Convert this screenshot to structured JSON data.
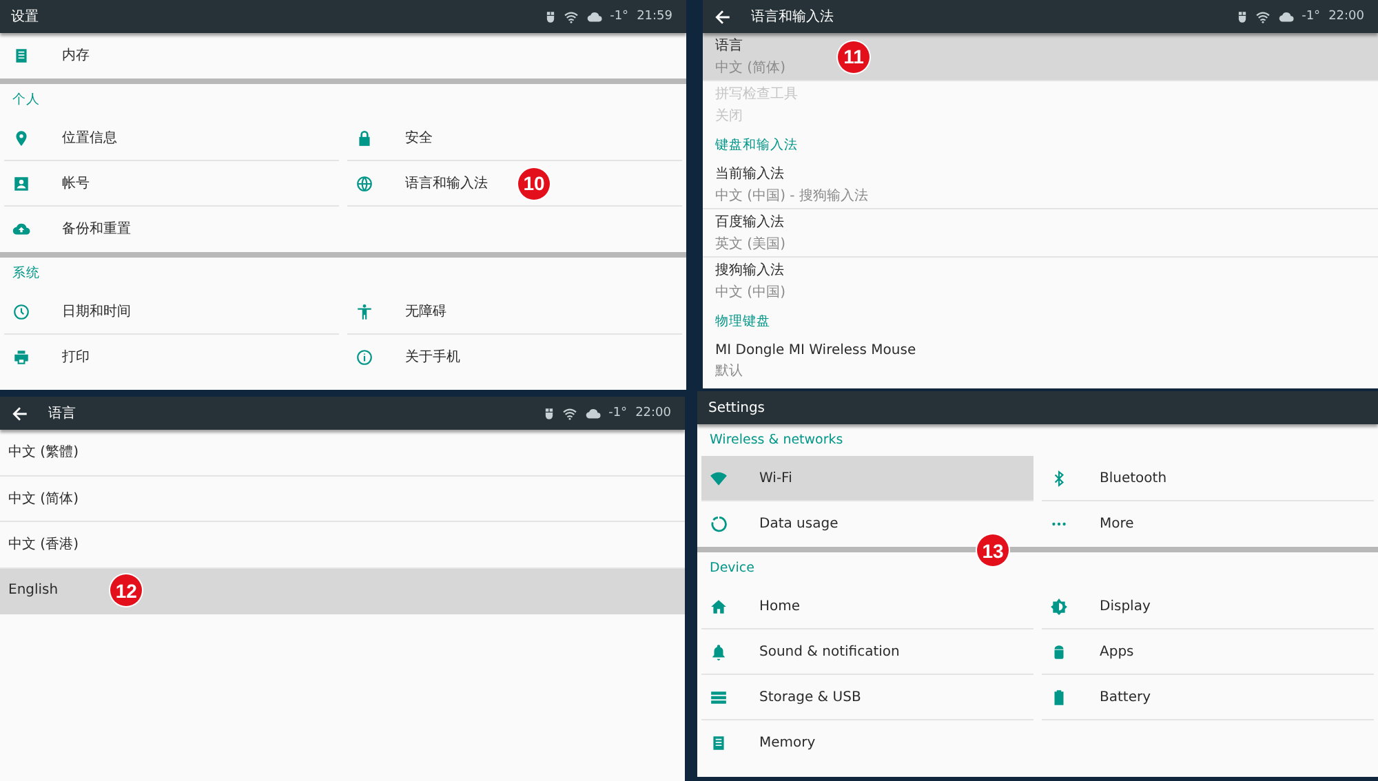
{
  "panels": [
    {
      "kind": "grid",
      "title": "设置",
      "back": false,
      "status": {
        "temperature": "-1°",
        "time": "21:59"
      },
      "sections": [
        {
          "items": [
            {
              "label": "内存",
              "selected": false
            }
          ]
        },
        {
          "header": "个人",
          "items": [
            {
              "label": "位置信息",
              "selected": false
            },
            {
              "label": "安全",
              "selected": false
            },
            {
              "label": "帐号",
              "selected": false
            },
            {
              "label": "语言和输入法",
              "selected": false,
              "badge": "10"
            },
            {
              "label": "备份和重置",
              "selected": false
            }
          ]
        },
        {
          "header": "系统",
          "items": [
            {
              "label": "日期和时间",
              "selected": false
            },
            {
              "label": "无障碍",
              "selected": false
            },
            {
              "label": "打印",
              "selected": false
            },
            {
              "label": "关于手机",
              "selected": false
            }
          ]
        }
      ]
    },
    {
      "kind": "list",
      "title": "语言和输入法",
      "back": true,
      "status": {
        "temperature": "-1°",
        "time": "22:00"
      },
      "sections": [
        {
          "items": [
            {
              "label": "语言",
              "summary": "中文 (简体)",
              "selected": true,
              "disabled": false,
              "badge": "11"
            },
            {
              "label": "拼写检查工具",
              "summary": "关闭",
              "selected": false,
              "disabled": true
            }
          ]
        },
        {
          "header": "键盘和输入法",
          "items": [
            {
              "label": "当前输入法",
              "summary": "中文 (中国) - 搜狗输入法",
              "selected": false,
              "disabled": false
            },
            {
              "label": "百度输入法",
              "summary": "英文 (美国)",
              "selected": false,
              "disabled": false
            },
            {
              "label": "搜狗输入法",
              "summary": "中文 (中国)",
              "selected": false,
              "disabled": false
            }
          ]
        },
        {
          "header": "物理键盘",
          "items": [
            {
              "label": "MI Dongle MI Wireless Mouse",
              "summary": "默认",
              "selected": false,
              "disabled": false
            }
          ]
        }
      ]
    },
    {
      "kind": "list",
      "title": "语言",
      "back": true,
      "status": {
        "temperature": "-1°",
        "time": "22:00"
      },
      "sections": [
        {
          "items": [
            {
              "label": "中文 (繁體)",
              "selected": false
            },
            {
              "label": "中文 (简体)",
              "selected": false
            },
            {
              "label": "中文 (香港)",
              "selected": false
            },
            {
              "label": "English",
              "selected": true,
              "badge": "12"
            }
          ]
        }
      ]
    },
    {
      "kind": "grid",
      "title": "Settings",
      "back": false,
      "sections": [
        {
          "header": "Wireless & networks",
          "badge": "13",
          "items": [
            {
              "label": "Wi-Fi",
              "selected": true
            },
            {
              "label": "Bluetooth",
              "selected": false
            },
            {
              "label": "Data usage",
              "selected": false
            },
            {
              "label": "More",
              "selected": false
            }
          ]
        },
        {
          "header": "Device",
          "items": [
            {
              "label": "Home",
              "selected": false
            },
            {
              "label": "Display",
              "selected": false
            },
            {
              "label": "Sound & notification",
              "selected": false
            },
            {
              "label": "Apps",
              "selected": false
            },
            {
              "label": "Storage & USB",
              "selected": false
            },
            {
              "label": "Battery",
              "selected": false
            },
            {
              "label": "Memory",
              "selected": false
            }
          ]
        }
      ]
    }
  ]
}
